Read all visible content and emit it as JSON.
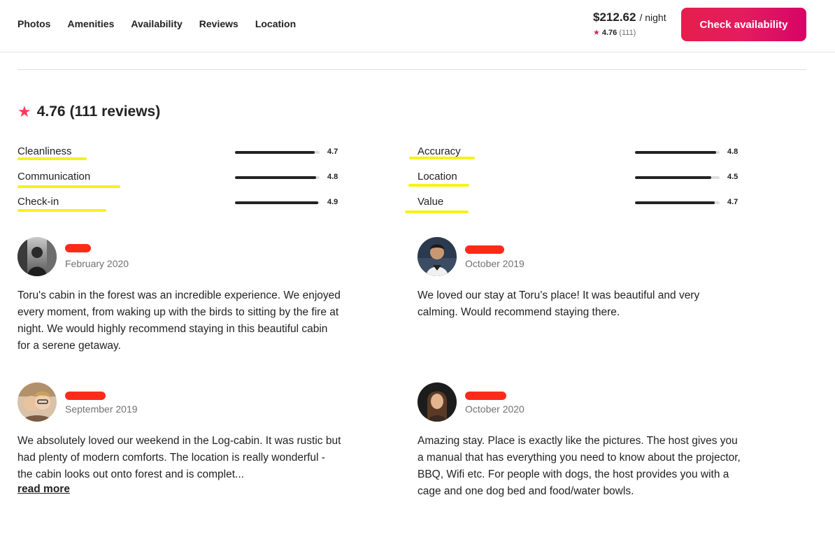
{
  "nav": {
    "items": [
      "Photos",
      "Amenities",
      "Availability",
      "Reviews",
      "Location"
    ]
  },
  "booking": {
    "price": "$212.62",
    "per_night": "/ night",
    "rating": "4.76",
    "review_count": "(111)",
    "cta_label": "Check availability",
    "accent_color": "#e31c5f"
  },
  "summary": {
    "score": "4.76",
    "reviews_text": "(111 reviews)"
  },
  "categories": [
    {
      "label": "Cleanliness",
      "value": "4.7",
      "fraction": 0.94
    },
    {
      "label": "Communication",
      "value": "4.8",
      "fraction": 0.96
    },
    {
      "label": "Check-in",
      "value": "4.9",
      "fraction": 0.98
    },
    {
      "label": "Accuracy",
      "value": "4.8",
      "fraction": 0.96
    },
    {
      "label": "Location",
      "value": "4.5",
      "fraction": 0.9
    },
    {
      "label": "Value",
      "value": "4.7",
      "fraction": 0.94
    }
  ],
  "reviews": [
    {
      "date": "February 2020",
      "text": "Toru's cabin in the forest was an incredible experience. We enjoyed every moment, from waking up with the birds to sitting by the fire at night. We would highly recommend staying in this beautiful cabin for a serene getaway."
    },
    {
      "date": "October 2019",
      "text": "We loved our stay at Toru’s place! It was beautiful and very calming. Would recommend staying there."
    },
    {
      "date": "September 2019",
      "text": "We absolutely loved our weekend in the Log-cabin. It was rustic but had plenty of modern comforts. The location is really wonderful - the cabin looks out onto forest and is complet...",
      "read_more": "read more"
    },
    {
      "date": "October 2020",
      "text": "Amazing stay. Place is exactly like the pictures. The host gives you a manual that has everything you need to know about the projector, BBQ, Wifi etc. For people with dogs, the host provides you with a cage and one dog bed and food/water bowls."
    }
  ]
}
